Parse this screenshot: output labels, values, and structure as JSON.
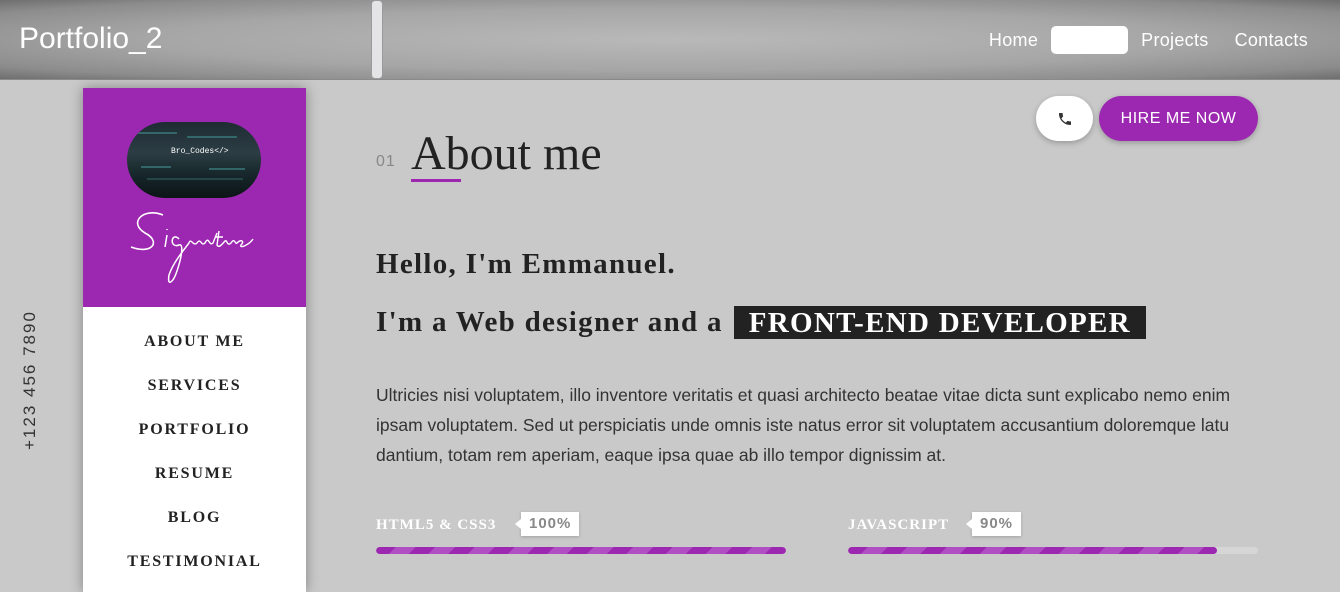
{
  "header": {
    "brand": "Portfolio_2",
    "nav": [
      "Home",
      "Projects",
      "Contacts"
    ]
  },
  "sidebar": {
    "phone": "+123 456 7890",
    "avatar_text": "Bro_Codes</>",
    "signature": "Signature",
    "menu": [
      "ABOUT ME",
      "SERVICES",
      "PORTFOLIO",
      "RESUME",
      "BLOG",
      "TESTIMONIAL"
    ]
  },
  "actions": {
    "call_icon": "phone-icon",
    "hire_label": "HIRE ME NOW"
  },
  "section": {
    "number": "01",
    "title": "About me"
  },
  "intro": {
    "hello": "Hello, I'm Emmanuel.",
    "role_prefix": "I'm a Web designer and a",
    "role_highlight": "FRONT-END DEVELOPER",
    "description": "Ultricies nisi voluptatem, illo inventore veritatis et quasi architecto beatae vitae dicta sunt explicabo nemo enim ipsam voluptatem. Sed ut perspiciatis unde omnis iste natus error sit voluptatem accusantium doloremque latu dantium, totam rem aperiam, eaque ipsa quae ab illo tempor dignissim at."
  },
  "skills": [
    {
      "name": "HTML5 & CSS3",
      "percent_label": "100%",
      "level": 1.0
    },
    {
      "name": "JAVASCRIPT",
      "percent_label": "90%",
      "level": 0.9
    }
  ],
  "colors": {
    "accent": "#9c27b0",
    "background": "#c9c9c9",
    "highlight_bg": "#222222"
  }
}
